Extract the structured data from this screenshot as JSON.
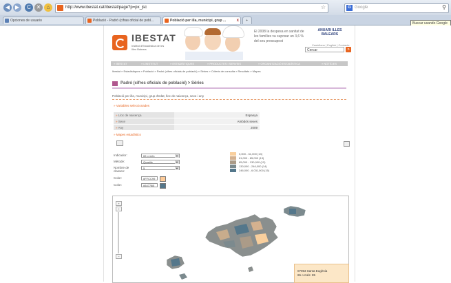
{
  "browser": {
    "url": "http://www.ibestat.cat/ibestat/page?p=px_jsc",
    "search_placeholder": "Google",
    "search_glyph": "G",
    "nav_glyphs": {
      "back": "◀",
      "forward": "▶",
      "reload": "C",
      "stop": "✕",
      "home": "⌂"
    },
    "star_glyph": "☆",
    "magnifier_glyph": "⚲",
    "tabs": [
      {
        "label": "Opciones de usuario"
      },
      {
        "label": "Població - Padró (cifras oficial de pobl..."
      },
      {
        "label": "Població per illa, municipi, grup ..."
      }
    ],
    "new_tab_glyph": "+",
    "tab_close_glyph": "x",
    "tooltip": "Buscar usando Google"
  },
  "site": {
    "brand": "IBESTAT",
    "brand_sub": "Institut d'Estadística de les Illes Balears",
    "headline": "El 2008 la despesa en sanitat de les famílies va suposar un 3,6 % del seu pressupost",
    "badge_title": "ANUARI ILLES BALEARS",
    "badge_links": "Castellano | English | Contacte",
    "search_box_value": "Cercar",
    "search_go_glyph": "»",
    "nav": [
      "» IBESTAT",
      "» L'INSTITUT",
      "» ESTADÍSTIQUES",
      "» PRODUCTES I SERVEIS",
      "» ORGANITZACIÓ ESTADÍSTICA",
      "» NOTÍCIES"
    ],
    "breadcrumb": "Ibestat » Estadístiques » Població » Padró (cifres oficials de població) » Sèries » Criteris de consulta » Resultats » Mapes"
  },
  "page": {
    "title": "Padró (cifres oficials de població) > Sèries",
    "subtitle": "Població per illa, municipi, grup d'edat, lloc de naixença, sexe i any",
    "section_variables": "Variables seleccionades",
    "section_map": "Mapes estadístics",
    "bullet_glyph": "»",
    "variables": [
      {
        "key": "Lloc de naixença",
        "value": "Espanya"
      },
      {
        "key": "Sexe",
        "value": "Ambdós sexes"
      },
      {
        "key": "Any",
        "value": "2009"
      }
    ]
  },
  "form": {
    "indicador_label": "Indicador:",
    "indicador_value": "65 o més",
    "metode_label": "Mètode:",
    "metode_value": "Quartils",
    "classes_label": "Nombre de classes:",
    "classes_value": "5",
    "color1_label": "Color:",
    "color1_value": "#FFCC99",
    "color2_label": "Color:",
    "color2_value": "#54778B",
    "dropdown_glyph": "▼"
  },
  "legend": [
    {
      "label": "0,000 - 61,000 (13)",
      "color": "#f9cf9d"
    },
    {
      "label": "61,000 - 85,000 (13)",
      "color": "#d4b18f"
    },
    {
      "label": "85,000 - 130,000 (12)",
      "color": "#ab9b88"
    },
    {
      "label": "130,000 - 246,000 (14)",
      "color": "#7c8a8e"
    },
    {
      "label": "246,000 - 6.031,000 (15)",
      "color": "#54778b"
    }
  ],
  "map": {
    "zoom_in_glyph": "+",
    "zoom_out_glyph": "−",
    "pan_glyph": "+",
    "tooltip_line1": "07053 Santa Eugènia",
    "tooltip_line2": "65 o més: 85"
  },
  "colors": {
    "accent": "#e8641f",
    "title_rule": "#d7b7d9"
  }
}
